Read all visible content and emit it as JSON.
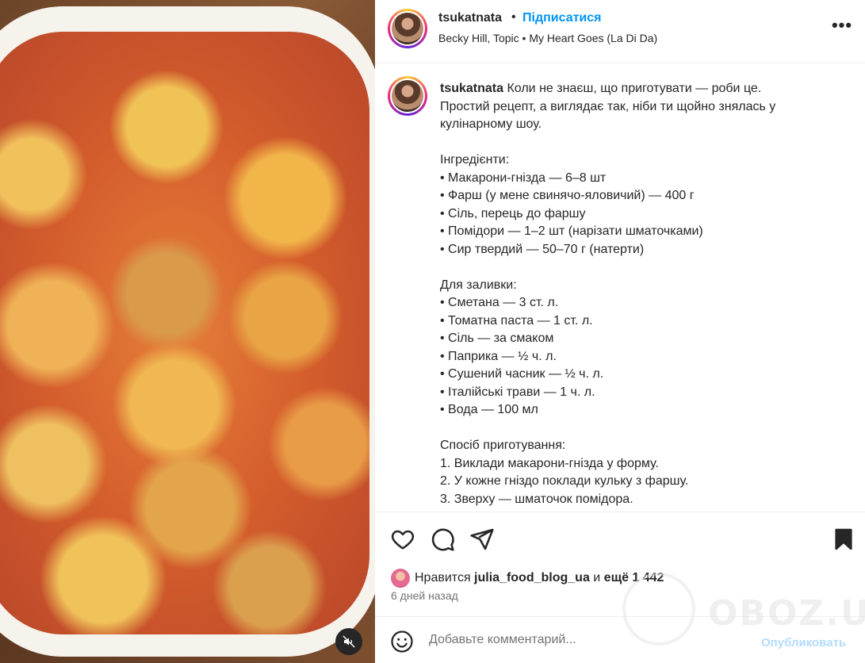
{
  "post": {
    "media_alt": "Запечені макаронні гнізда з фрикадельками, помідорами та сиром"
  },
  "header": {
    "username": "tsukatnata",
    "dot": "•",
    "follow_label": "Підписатися",
    "audio": "Becky Hill, Topic • My Heart Goes (La Di Da)",
    "more_label": "•••"
  },
  "caption": {
    "username": "tsukatnata",
    "lines": [
      " Коли не знаєш, що приготувати — роби це.",
      "Простий рецепт, а виглядає так, ніби ти щойно знялась у",
      "кулінарному шоу.",
      "",
      "Інгредієнти:",
      "• Макарони-гнізда — 6–8 шт",
      "• Фарш (у мене свинячо-яловичий) — 400 г",
      "• Сіль, перець до фаршу",
      "• Помідори — 1–2 шт (нарізати шматочками)",
      "• Сир твердий — 50–70 г (натерти)",
      "",
      "Для заливки:",
      "• Сметана — 3 ст. л.",
      "• Томатна паста — 1 ст. л.",
      "• Сіль — за смаком",
      "• Паприка — ½ ч. л.",
      "• Сушений часник — ½ ч. л.",
      "• Італійські трави — 1 ч. л.",
      "• Вода — 100 мл",
      "",
      "Спосіб приготування:",
      "1. Виклади макарони-гнізда у форму.",
      "2. У кожне гніздо поклади кульку з фаршу.",
      "3. Зверху — шматочок помідора."
    ]
  },
  "likes": {
    "prefix": "Нравится ",
    "user": "julia_food_blog_ua",
    "middle": " и ",
    "count": "ещё 1 442"
  },
  "time": "6 дней назад",
  "comment": {
    "placeholder": "Добавьте комментарий...",
    "publish_label": "Опубликовать"
  },
  "watermark": {
    "text": "OBOZ.UA"
  },
  "colors": {
    "accent": "#0095f6",
    "publish_disabled": "#b3dbff",
    "text": "#262626",
    "muted": "#737373"
  }
}
